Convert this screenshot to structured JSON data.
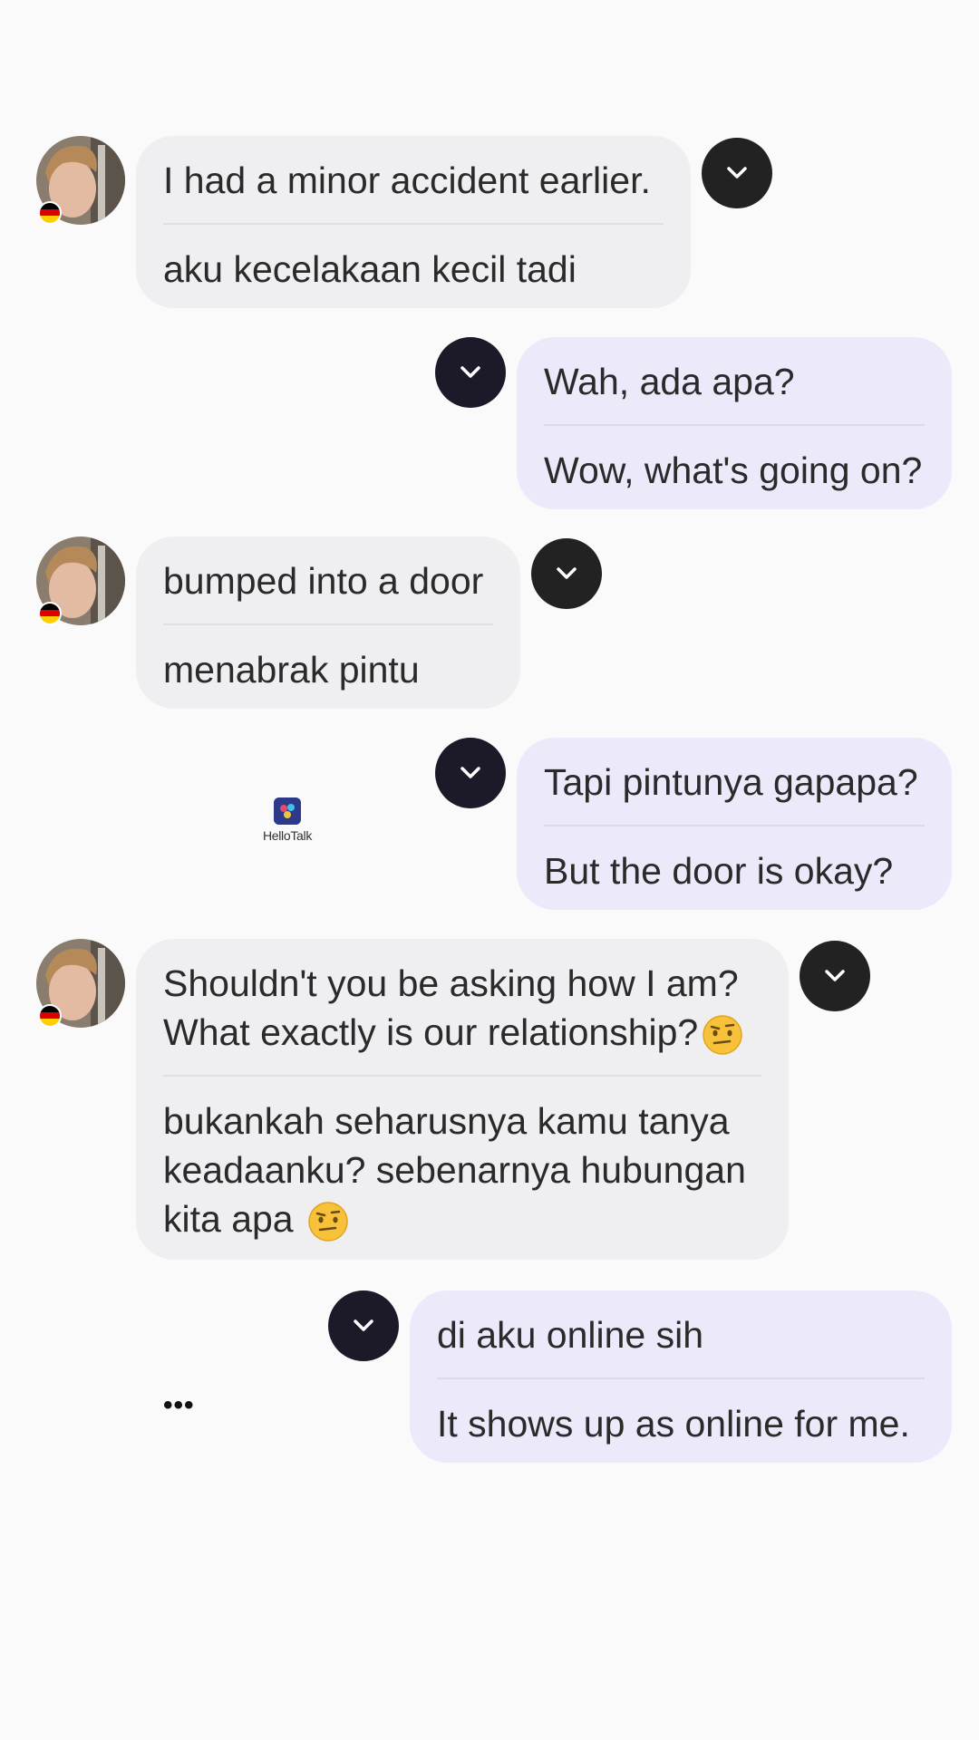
{
  "messages": [
    {
      "direction": "in",
      "original": "I had a minor accident earlier.",
      "translation": "aku kecelakaan kecil tadi"
    },
    {
      "direction": "out",
      "original": "Wah, ada apa?",
      "translation": "Wow, what's going on?"
    },
    {
      "direction": "in",
      "original": "bumped into a door",
      "translation": "menabrak pintu"
    },
    {
      "direction": "out",
      "original": "Tapi pintunya gapapa?",
      "translation": "But the door is okay?"
    },
    {
      "direction": "in",
      "original_lines": [
        "Shouldn't you be asking how I am?",
        "What exactly is our relationship?"
      ],
      "translation_lines": [
        "bukankah seharusnya kamu tanya",
        "keadaanku? sebenarnya hubungan",
        "kita apa"
      ],
      "emoji": "smirk-face-icon"
    },
    {
      "direction": "out",
      "original": "di aku online sih",
      "translation": "It shows up as online for me."
    }
  ],
  "watermark": {
    "text": "HelloTalk"
  },
  "more_indicator": "•••",
  "colors": {
    "incoming_bubble": "#efeef1",
    "outgoing_bubble": "#ece9fb",
    "chevron_button": "#1c1a28",
    "flag": [
      "#000000",
      "#dd0000",
      "#ffce00"
    ]
  }
}
